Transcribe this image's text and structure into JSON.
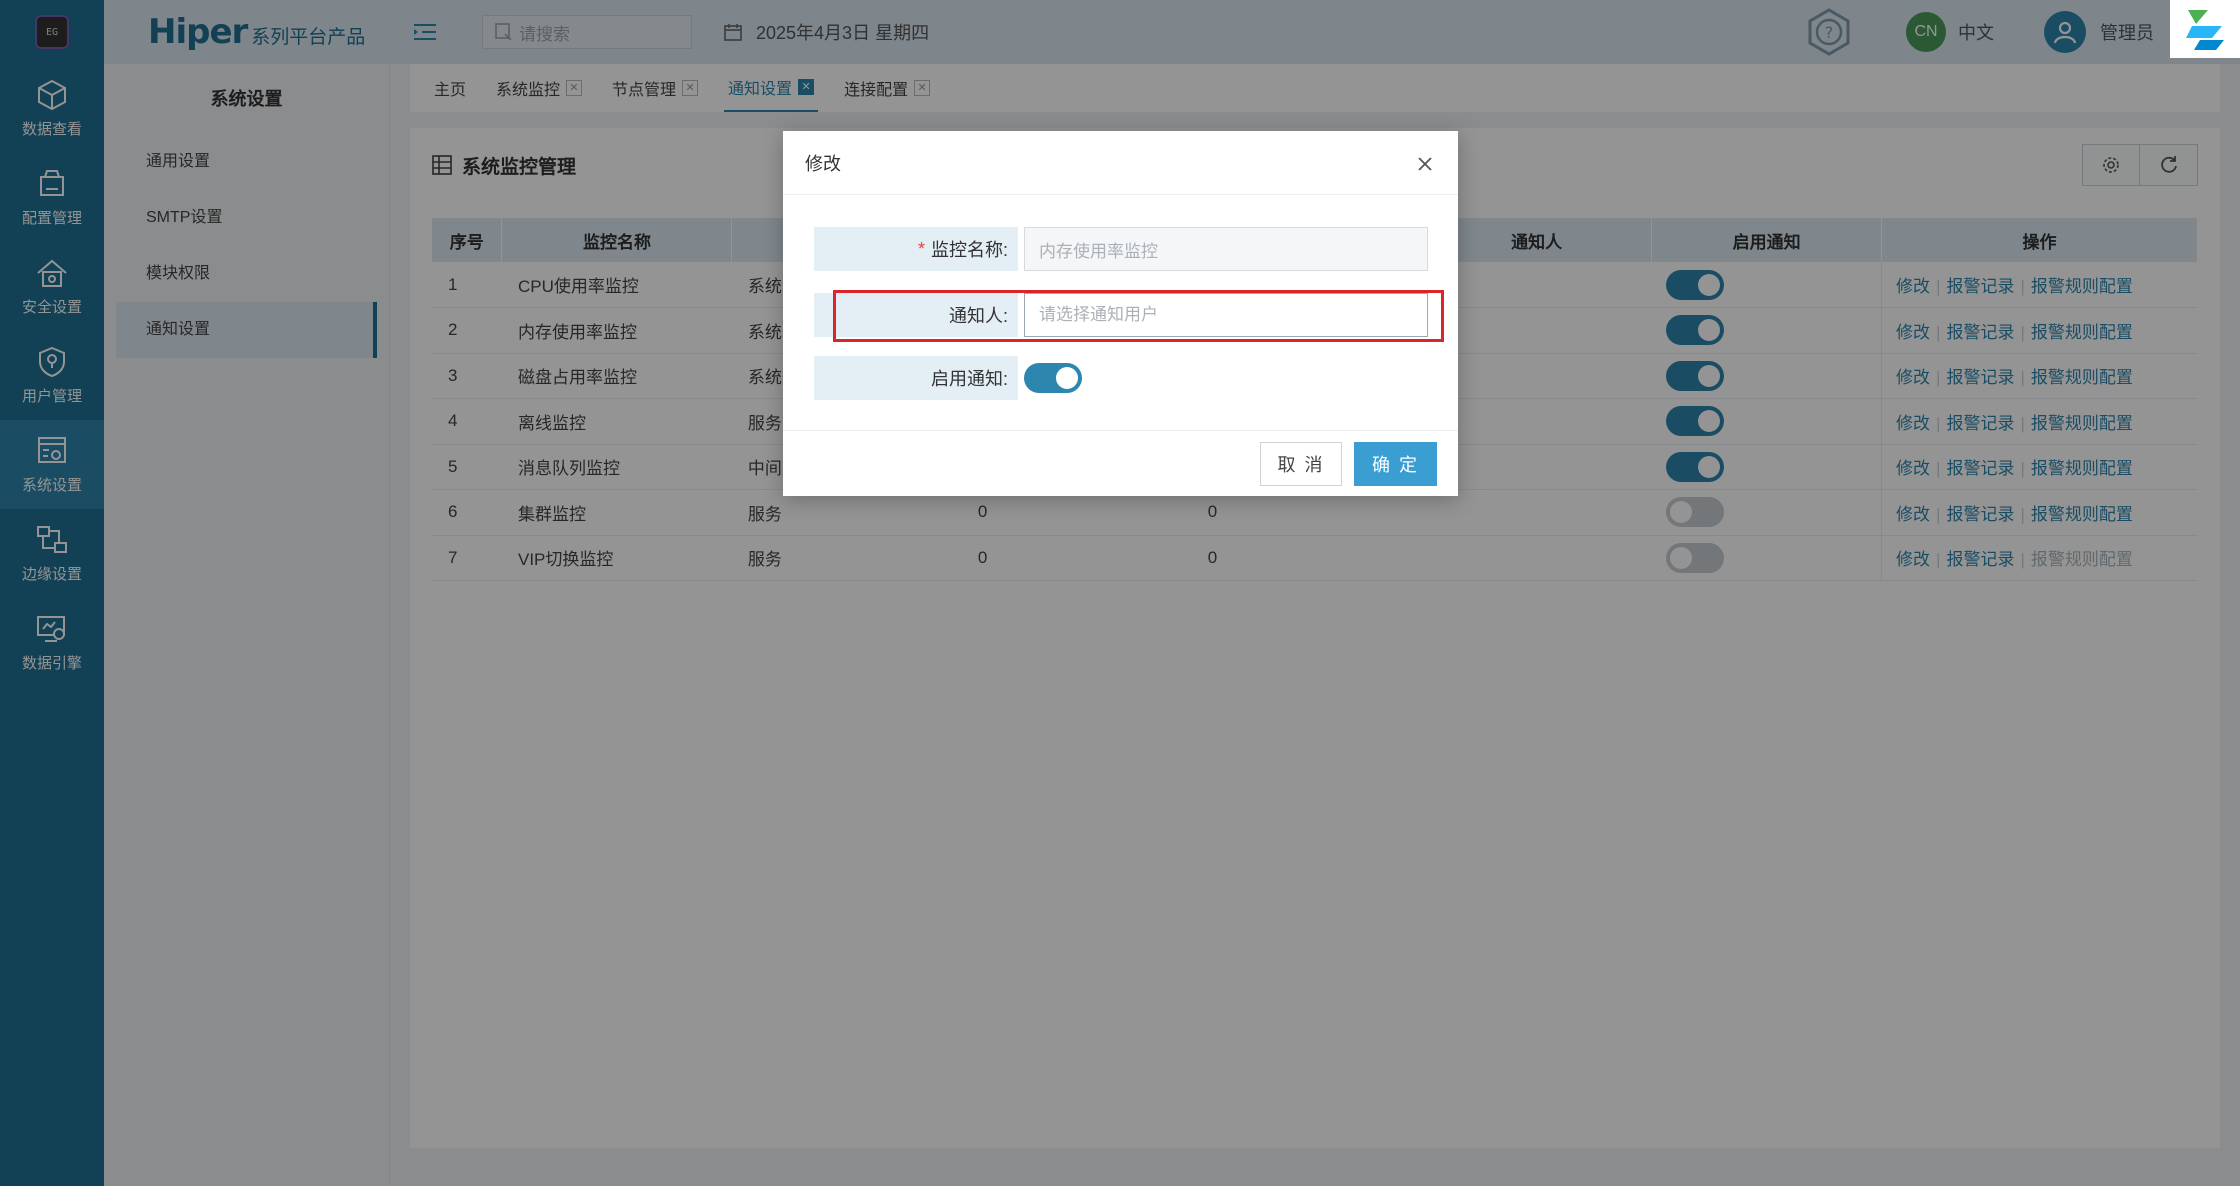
{
  "brand": {
    "name": "Hiper",
    "subtitle": "系列平台产品",
    "logo_text": "EG"
  },
  "rail": [
    {
      "name": "rail-data-view",
      "icon": "cube-icon",
      "label": "数据查看"
    },
    {
      "name": "rail-config-manage",
      "icon": "config-icon",
      "label": "配置管理"
    },
    {
      "name": "rail-security",
      "icon": "security-home-icon",
      "label": "安全设置"
    },
    {
      "name": "rail-user-manage",
      "icon": "user-shield-icon",
      "label": "用户管理"
    },
    {
      "name": "rail-system-settings",
      "icon": "system-settings-icon",
      "label": "系统设置",
      "active": true
    },
    {
      "name": "rail-edge-settings",
      "icon": "edge-network-icon",
      "label": "边缘设置"
    },
    {
      "name": "rail-data-engine",
      "icon": "data-engine-icon",
      "label": "数据引擎"
    }
  ],
  "topbar": {
    "search_placeholder": "请搜索",
    "date": "2025年4月3日 星期四",
    "lang_badge": "CN",
    "lang_label": "中文",
    "user_label": "管理员"
  },
  "side_menu": {
    "title": "系统设置",
    "items": [
      "通用设置",
      "SMTP设置",
      "模块权限",
      "通知设置"
    ],
    "active_index": 3
  },
  "tabs": [
    {
      "label": "主页",
      "closable": false
    },
    {
      "label": "系统监控",
      "closable": true
    },
    {
      "label": "节点管理",
      "closable": true
    },
    {
      "label": "通知设置",
      "closable": true,
      "active": true
    },
    {
      "label": "连接配置",
      "closable": true
    }
  ],
  "panel": {
    "title": "系统监控管理",
    "columns": [
      "序号",
      "监控名称",
      "",
      "",
      "",
      "通知人",
      "启用通知",
      "操作"
    ],
    "rows": [
      {
        "no": "1",
        "name": "CPU使用率监控",
        "type": "系统",
        "v1": "",
        "v2": "",
        "notify": "",
        "enabled": true,
        "ops": [
          "修改",
          "报警记录",
          "报警规则配置"
        ],
        "ops_disabled": []
      },
      {
        "no": "2",
        "name": "内存使用率监控",
        "type": "系统",
        "v1": "",
        "v2": "",
        "notify": "",
        "enabled": true,
        "ops": [
          "修改",
          "报警记录",
          "报警规则配置"
        ],
        "ops_disabled": []
      },
      {
        "no": "3",
        "name": "磁盘占用率监控",
        "type": "系统",
        "v1": "",
        "v2": "",
        "notify": "",
        "enabled": true,
        "ops": [
          "修改",
          "报警记录",
          "报警规则配置"
        ],
        "ops_disabled": []
      },
      {
        "no": "4",
        "name": "离线监控",
        "type": "服务",
        "v1": "",
        "v2": "",
        "notify": "",
        "enabled": true,
        "ops": [
          "修改",
          "报警记录",
          "报警规则配置"
        ],
        "ops_disabled": []
      },
      {
        "no": "5",
        "name": "消息队列监控",
        "type": "中间",
        "v1": "",
        "v2": "",
        "notify": "",
        "enabled": true,
        "ops": [
          "修改",
          "报警记录",
          "报警规则配置"
        ],
        "ops_disabled": []
      },
      {
        "no": "6",
        "name": "集群监控",
        "type": "服务",
        "v1": "0",
        "v2": "0",
        "notify": "",
        "enabled": false,
        "ops": [
          "修改",
          "报警记录",
          "报警规则配置"
        ],
        "ops_disabled": []
      },
      {
        "no": "7",
        "name": "VIP切换监控",
        "type": "服务",
        "v1": "0",
        "v2": "0",
        "notify": "",
        "enabled": false,
        "ops": [
          "修改",
          "报警记录",
          "报警规则配置"
        ],
        "ops_disabled": [
          2
        ]
      }
    ]
  },
  "dialog": {
    "title": "修改",
    "fields": {
      "monitor_name_label": "监控名称:",
      "monitor_name_value": "内存使用率监控",
      "notify_user_label": "通知人:",
      "notify_user_placeholder": "请选择通知用户",
      "enable_label": "启用通知:",
      "enable_value": true
    },
    "cancel_label": "取 消",
    "ok_label": "确 定"
  },
  "colors": {
    "rail_bg": "#1f6f92",
    "accent": "#2d86ad",
    "primary_button": "#3a9ed3",
    "highlight_border": "#d8262a",
    "required": "#e0443a"
  }
}
